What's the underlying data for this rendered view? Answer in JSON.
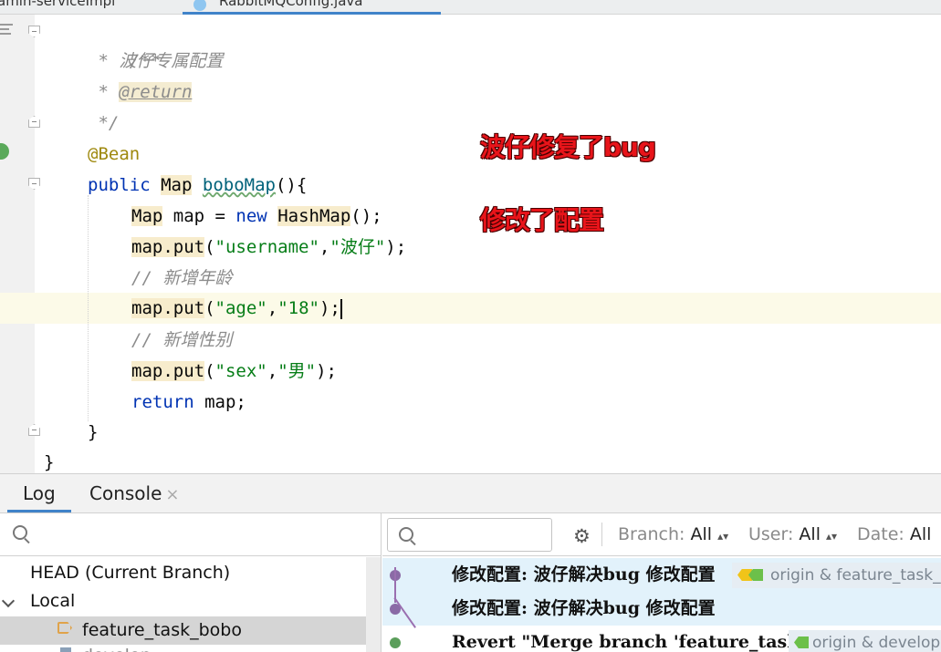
{
  "tabs": [
    {
      "label": "amin-serviceImpl"
    },
    {
      "label": "RabbitMQConfig.java"
    }
  ],
  "editor": {
    "overlay_notes": [
      "波仔修复了bug",
      "修改了配置"
    ],
    "code": {
      "l1": "/**",
      "l2_prefix": " * ",
      "l2_text": "波仔专属配置",
      "l3_prefix": " * ",
      "l3_tag": "@return",
      "l4": " */",
      "l5": "@Bean",
      "l6_kw": "public",
      "l6_type": "Map",
      "l6_name": "boboMap",
      "l6_tail": "(){",
      "l7_type": "Map",
      "l7_mid": " map = ",
      "l7_kw": "new",
      "l7_ctor": "HashMap",
      "l7_tail": "();",
      "l8_call": "map.put",
      "l8_open": "(",
      "l8_arg1": "\"username\"",
      "l8_sep": ",",
      "l8_arg2": "\"波仔\"",
      "l8_close": ");",
      "l9": "// 新增年龄",
      "l10_call": "map.put",
      "l10_open": "(",
      "l10_arg1": "\"age\"",
      "l10_sep": ",",
      "l10_arg2": "\"18\"",
      "l10_close": ");",
      "l11": "// 新增性别",
      "l12_call": "map.put",
      "l12_open": "(",
      "l12_arg1": "\"sex\"",
      "l12_sep": ",",
      "l12_arg2": "\"男\"",
      "l12_close": ");",
      "l13_kw": "return",
      "l13_tail": " map;",
      "l14": "}",
      "l15": "}"
    }
  },
  "tool_window": {
    "tabs": {
      "log": "Log",
      "console": "Console",
      "console_close": "×"
    },
    "branches": {
      "head": "HEAD (Current Branch)",
      "local": "Local",
      "selected": "feature_task_bobo",
      "next_partial": "develop"
    },
    "filters": {
      "branch_label": "Branch:",
      "branch_value": "All",
      "user_label": "User:",
      "user_value": "All",
      "date_label": "Date:",
      "date_value": "All"
    },
    "commits": [
      {
        "message": "修改配置: 波仔解决bug 修改配置",
        "refs": "origin & feature_task_bobo",
        "selected": true,
        "dot_color": "#8a6aa6"
      },
      {
        "message": "修改配置: 波仔解决bug 修改配置",
        "refs": "",
        "selected": true,
        "dot_color": "#8a6aa6"
      },
      {
        "message": "Revert \"Merge branch 'feature_task_bobo'",
        "refs": "origin & develop",
        "selected": false,
        "dot_color": "#5b9e5b"
      }
    ]
  },
  "colors": {
    "accent": "#4083c9",
    "overlay_text": "#e8141a",
    "current_line": "#fcfae8"
  }
}
